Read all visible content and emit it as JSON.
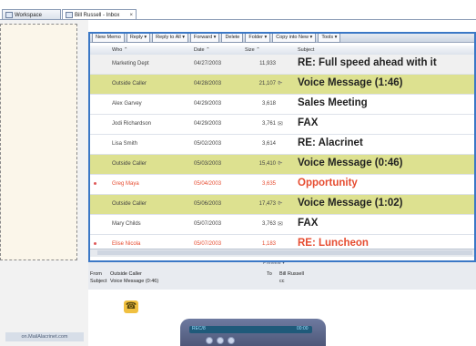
{
  "tabs": [
    {
      "label": "Workspace",
      "icon": "workspace-icon"
    },
    {
      "label": "Bill Russell - Inbox",
      "close": "×",
      "icon": "inbox-icon"
    }
  ],
  "toolbar": [
    "New Memo",
    "Reply ▾",
    "Reply to All ▾",
    "Forward ▾",
    "Delete",
    "Folder ▾",
    "Copy into New ▾",
    "Tools ▾"
  ],
  "columns": {
    "who": "Who ⌃",
    "date": "Date ⌃",
    "size": "Size ⌃",
    "subject": "Subject"
  },
  "rows": [
    {
      "who": "Marketing Dept",
      "date": "04/27/2003",
      "size": "11,933",
      "subject": "RE: Full speed ahead with it",
      "flag": "",
      "style": "overlay"
    },
    {
      "who": "Outside Caller",
      "date": "04/28/2003",
      "size": "21,107",
      "subject": "Voice Message (1:46)",
      "flag": "⌱",
      "style": "highlight"
    },
    {
      "who": "Alex Garvey",
      "date": "04/29/2003",
      "size": "3,618",
      "subject": "Sales Meeting",
      "flag": "",
      "style": ""
    },
    {
      "who": "Jodi Richardson",
      "date": "04/29/2003",
      "size": "3,761",
      "subject": "FAX",
      "flag": "✉",
      "style": ""
    },
    {
      "who": "Lisa Smith",
      "date": "05/02/2003",
      "size": "3,614",
      "subject": "RE: Alacrinet",
      "flag": "",
      "style": ""
    },
    {
      "who": "Outside Caller",
      "date": "05/03/2003",
      "size": "15,410",
      "subject": "Voice Message (0:46)",
      "flag": "⌱",
      "style": "highlight"
    },
    {
      "who": "Greg Maya",
      "date": "05/04/2003",
      "size": "3,635",
      "subject": "Opportunity",
      "flag": "",
      "style": "red"
    },
    {
      "who": "Outside Caller",
      "date": "05/06/2003",
      "size": "17,473",
      "subject": "Voice Message (1:02)",
      "flag": "⌱",
      "style": "highlight"
    },
    {
      "who": "Mary Childs",
      "date": "05/07/2003",
      "size": "3,763",
      "subject": "FAX",
      "flag": "✉",
      "style": ""
    },
    {
      "who": "Elise Nicola",
      "date": "05/07/2003",
      "size": "1,183",
      "subject": "RE: Luncheon",
      "flag": "",
      "style": "red"
    }
  ],
  "preview": {
    "title": "Preview ▾",
    "from_label": "From",
    "from": "Outside Caller",
    "subject_label": "Subject",
    "subject": "Voice Message (0:46)",
    "to_label": "To",
    "to": "Bill Russell",
    "cc_label": "cc"
  },
  "player": {
    "left_label": "REC/8",
    "right_label": "00:00"
  },
  "url": "on.MailAlacrinet.com",
  "colors": {
    "highlight": "#dde190",
    "overlay": "#f0f0f0",
    "accent": "#3b78c6",
    "unread": "#e64c30"
  }
}
